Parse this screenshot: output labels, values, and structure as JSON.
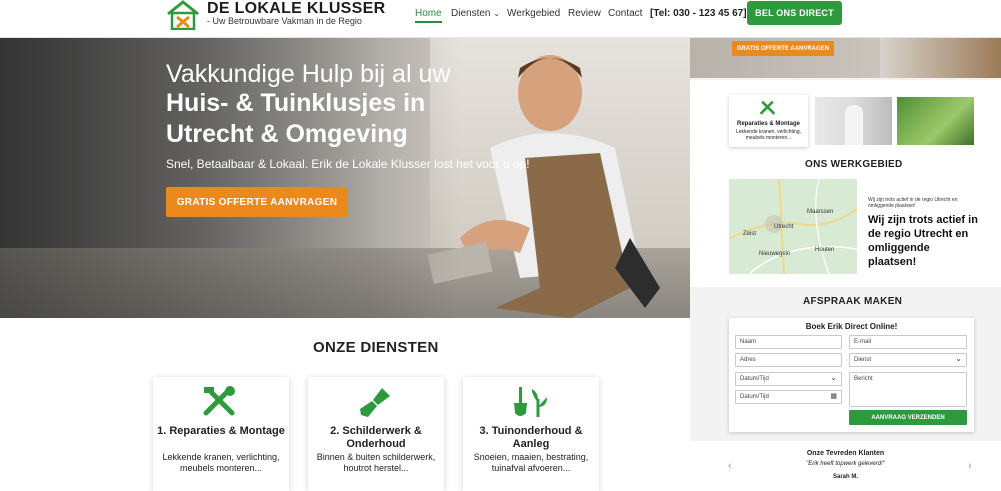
{
  "header": {
    "logo_title": "DE LOKALE KLUSSER",
    "logo_tagline": "- Uw Betrouwbare Vakman in de Regio",
    "nav": [
      "Home",
      "Diensten",
      "Werkgebied",
      "Review",
      "Contact"
    ],
    "phone": "[Tel: 030 - 123 45 67]",
    "call_button": "BEL ONS DIRECT"
  },
  "hero": {
    "line1": "Vakkundige Hulp bij al uw",
    "line2": "Huis- & Tuinklusjes in Utrecht & Omgeving",
    "subtitle": "Snel, Betaalbaar & Lokaal. Erik de Lokale Klusser lost het voor u op!",
    "cta": "GRATIS OFFERTE AANVRAGEN"
  },
  "services": {
    "title": "ONZE DIENSTEN",
    "cards": [
      {
        "icon": "tools-icon",
        "title": "1. Reparaties & Montage",
        "desc": "Lekkende kranen, verlichting, meubels monteren..."
      },
      {
        "icon": "paintbrush-icon",
        "title": "2. Schilderwerk & Onderhoud",
        "desc": "Binnen & buiten schilderwerk, houtrot herstel..."
      },
      {
        "icon": "shovel-plant-icon",
        "title": "3. Tuinonderhoud & Aanleg",
        "desc": "Snoeien, maaien, bestrating, tuinafval afvoeren..."
      }
    ]
  },
  "right_panel": {
    "top_cta": "GRATIS OFFERTE AANVRAGEN",
    "thumb_card": {
      "title": "Reparaties & Montage",
      "desc": "Lekkende kranen, verlichting, meubels monteren..."
    },
    "werkgebied_title": "ONS WERKGEBIED",
    "map_labels": [
      "Utrecht",
      "Zeist",
      "Maarssen",
      "Nieuwegein",
      "Houten"
    ],
    "werk_small": "Wij zijn trots actief in de regio Utrecht en omliggende plaatsen!",
    "werk_big": "Wij zijn trots actief in de regio Utrecht en omliggende plaatsen!",
    "afspraak_title": "AFSPRAAK MAKEN",
    "form_title": "Boek Erik Direct Online!",
    "fields": {
      "naam": "Naam",
      "email": "E-mail",
      "adres": "Adres",
      "dienst": "Dienst",
      "datum1": "Datum/Tijd",
      "bericht": "Bericht",
      "datum2": "Datum/Tijd"
    },
    "submit": "AANVRAAG VERZENDEN",
    "testimonials_title": "Onze Tevreden Klanten",
    "quote": "\"Erik heeft topwerk geleverd!\"",
    "author": "Sarah M."
  },
  "colors": {
    "brand_green": "#2e9a3e",
    "accent_orange": "#ea8a1c"
  }
}
